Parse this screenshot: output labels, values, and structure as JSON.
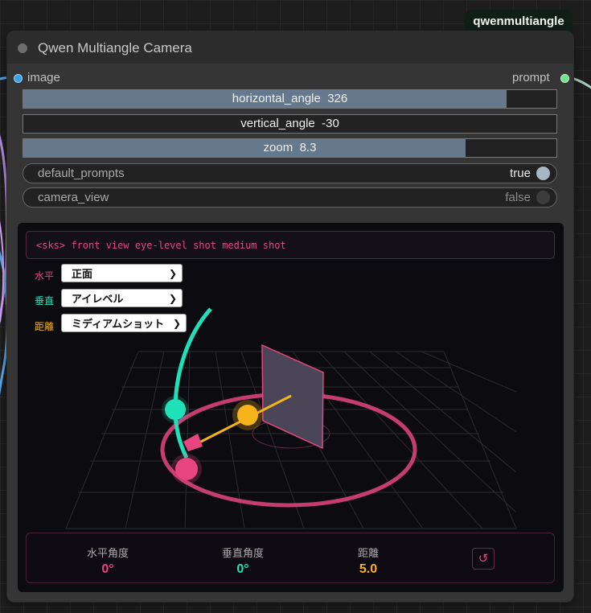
{
  "node": {
    "badge": "qwenmultiangle",
    "title": "Qwen Multiangle Camera",
    "input_label": "image",
    "output_label": "prompt"
  },
  "widgets": {
    "sliders": [
      {
        "name": "horizontal_angle",
        "value": "326",
        "fraction": 0.906
      },
      {
        "name": "vertical_angle",
        "value": "-30",
        "fraction": 0.0
      },
      {
        "name": "zoom",
        "value": "8.3",
        "fraction": 0.83
      }
    ],
    "toggles": [
      {
        "name": "default_prompts",
        "value": "true",
        "on": true
      },
      {
        "name": "camera_view",
        "value": "false",
        "on": false
      }
    ]
  },
  "camera_panel": {
    "prompt_text": "<sks> front view eye-level shot medium shot",
    "selects": [
      {
        "label": "水平",
        "value": "正面",
        "color": "#e6457f"
      },
      {
        "label": "垂直",
        "value": "アイレベル",
        "color": "#1fe0b8"
      },
      {
        "label": "距離",
        "value": "ミディアムショット",
        "color": "#f5b21a"
      }
    ],
    "stats": [
      {
        "label": "水平角度",
        "value": "0°",
        "color": "#e6457f"
      },
      {
        "label": "垂直角度",
        "value": "0°",
        "color": "#1fe0b8"
      },
      {
        "label": "距離",
        "value": "5.0",
        "color": "#f5b21a"
      }
    ],
    "reset_icon": "refresh-icon"
  },
  "colors": {
    "pink": "#e6457f",
    "teal": "#1fe0b8",
    "gold": "#f5b21a",
    "slider_fill": "#66788b"
  }
}
